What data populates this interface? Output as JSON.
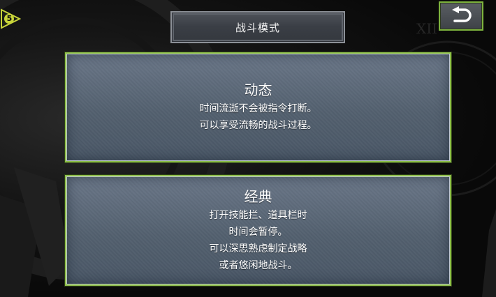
{
  "header": {
    "title": "战斗模式",
    "badge_number": "5",
    "back_icon": "undo-arrow-icon"
  },
  "modes": [
    {
      "title": "动态",
      "lines": [
        "时间流逝不会被指令打断。",
        "可以享受流畅的战斗过程。"
      ]
    },
    {
      "title": "经典",
      "lines": [
        "打开技能拦、道具栏时",
        "时间会暂停。",
        "可以深思熟虑制定战略",
        "或者悠闲地战斗。"
      ]
    }
  ],
  "colors": {
    "accent_green": "#8fc04a",
    "card_bg": "#5a6776",
    "badge_yellow": "#c8d43a"
  }
}
